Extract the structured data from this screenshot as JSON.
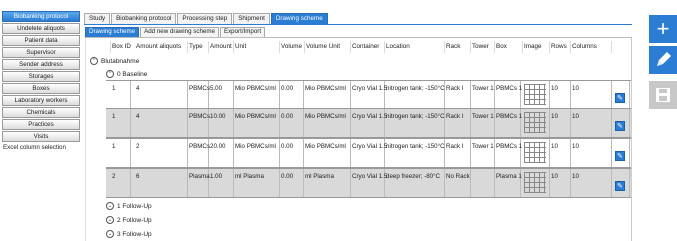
{
  "nav": {
    "items": [
      {
        "label": "Biobanking protocol",
        "active": true
      },
      {
        "label": "Undelete aliquots"
      },
      {
        "label": "Patient data"
      },
      {
        "label": "Supervisor"
      },
      {
        "label": "Sender address"
      },
      {
        "label": "Storages"
      },
      {
        "label": "Boxes"
      },
      {
        "label": "Laboratory workers"
      },
      {
        "label": "Chemicals"
      },
      {
        "label": "Practices"
      },
      {
        "label": "Visits"
      },
      {
        "label": "Excel column selection"
      }
    ]
  },
  "tabs": [
    "Study",
    "Biobanking protocol",
    "Processing step",
    "Shipment",
    "Drawing scheme"
  ],
  "active_tab": "Drawing scheme",
  "subtabs": [
    "Drawing scheme",
    "Add new drawing scheme",
    "Export/Import"
  ],
  "active_subtab": "Drawing scheme",
  "columns": [
    "Box ID",
    "Amount aliquots",
    "Type",
    "Amount",
    "Unit",
    "Volume",
    "Volume Unit",
    "Container",
    "Location",
    "Rack",
    "Tower",
    "Box",
    "Image",
    "Rows",
    "Columns"
  ],
  "groups": {
    "top": "Blutabnahme",
    "baseline": "0 Baseline",
    "followups": [
      "1 Follow-Up",
      "2 Follow-Up",
      "3 Follow-Up"
    ]
  },
  "rows": [
    {
      "box_id": "1",
      "amount_aliquots": "4",
      "type": "PBMCs",
      "amount": "5.00",
      "unit": "Mio PBMCs/ml",
      "volume": "0.00",
      "volume_unit": "Mio PBMCs/ml",
      "container": "Cryo Vial 1.5",
      "location": "nitrogen tank; -150°C",
      "rack": "Rack I",
      "tower": "Tower 1",
      "box": "PBMCs 1",
      "rows": "10",
      "columns": "10",
      "shade": "white"
    },
    {
      "box_id": "1",
      "amount_aliquots": "4",
      "type": "PBMCs",
      "amount": "10.00",
      "unit": "Mio PBMCs/ml",
      "volume": "0.00",
      "volume_unit": "Mio PBMCs/ml",
      "container": "Cryo Vial 1.5",
      "location": "nitrogen tank; -150°C",
      "rack": "Rack I",
      "tower": "Tower 1",
      "box": "PBMCs 1",
      "rows": "10",
      "columns": "10",
      "shade": "grey"
    },
    {
      "box_id": "1",
      "amount_aliquots": "2",
      "type": "PBMCs",
      "amount": "20.00",
      "unit": "Mio PBMCs/ml",
      "volume": "0.00",
      "volume_unit": "Mio PBMCs/ml",
      "container": "Cryo Vial 1.5",
      "location": "nitrogen tank; -150°C",
      "rack": "Rack I",
      "tower": "Tower 1",
      "box": "PBMCs 1",
      "rows": "10",
      "columns": "10",
      "shade": "white"
    },
    {
      "box_id": "2",
      "amount_aliquots": "6",
      "type": "Plasma",
      "amount": "1.00",
      "unit": "ml Plasma",
      "volume": "0.00",
      "volume_unit": "ml Plasma",
      "container": "Cryo Vial 1.5",
      "location": "deep freezer; -80°C",
      "rack": "No Rack",
      "tower": "",
      "box": "Plasma 1",
      "rows": "10",
      "columns": "10",
      "shade": "grey"
    }
  ],
  "toolbar": {
    "add_icon": "plus-icon",
    "edit_icon": "pencil-icon",
    "save_icon": "save-icon"
  },
  "colors": {
    "accent": "#2b7cd3",
    "row_shade": "#d9d9d9"
  }
}
